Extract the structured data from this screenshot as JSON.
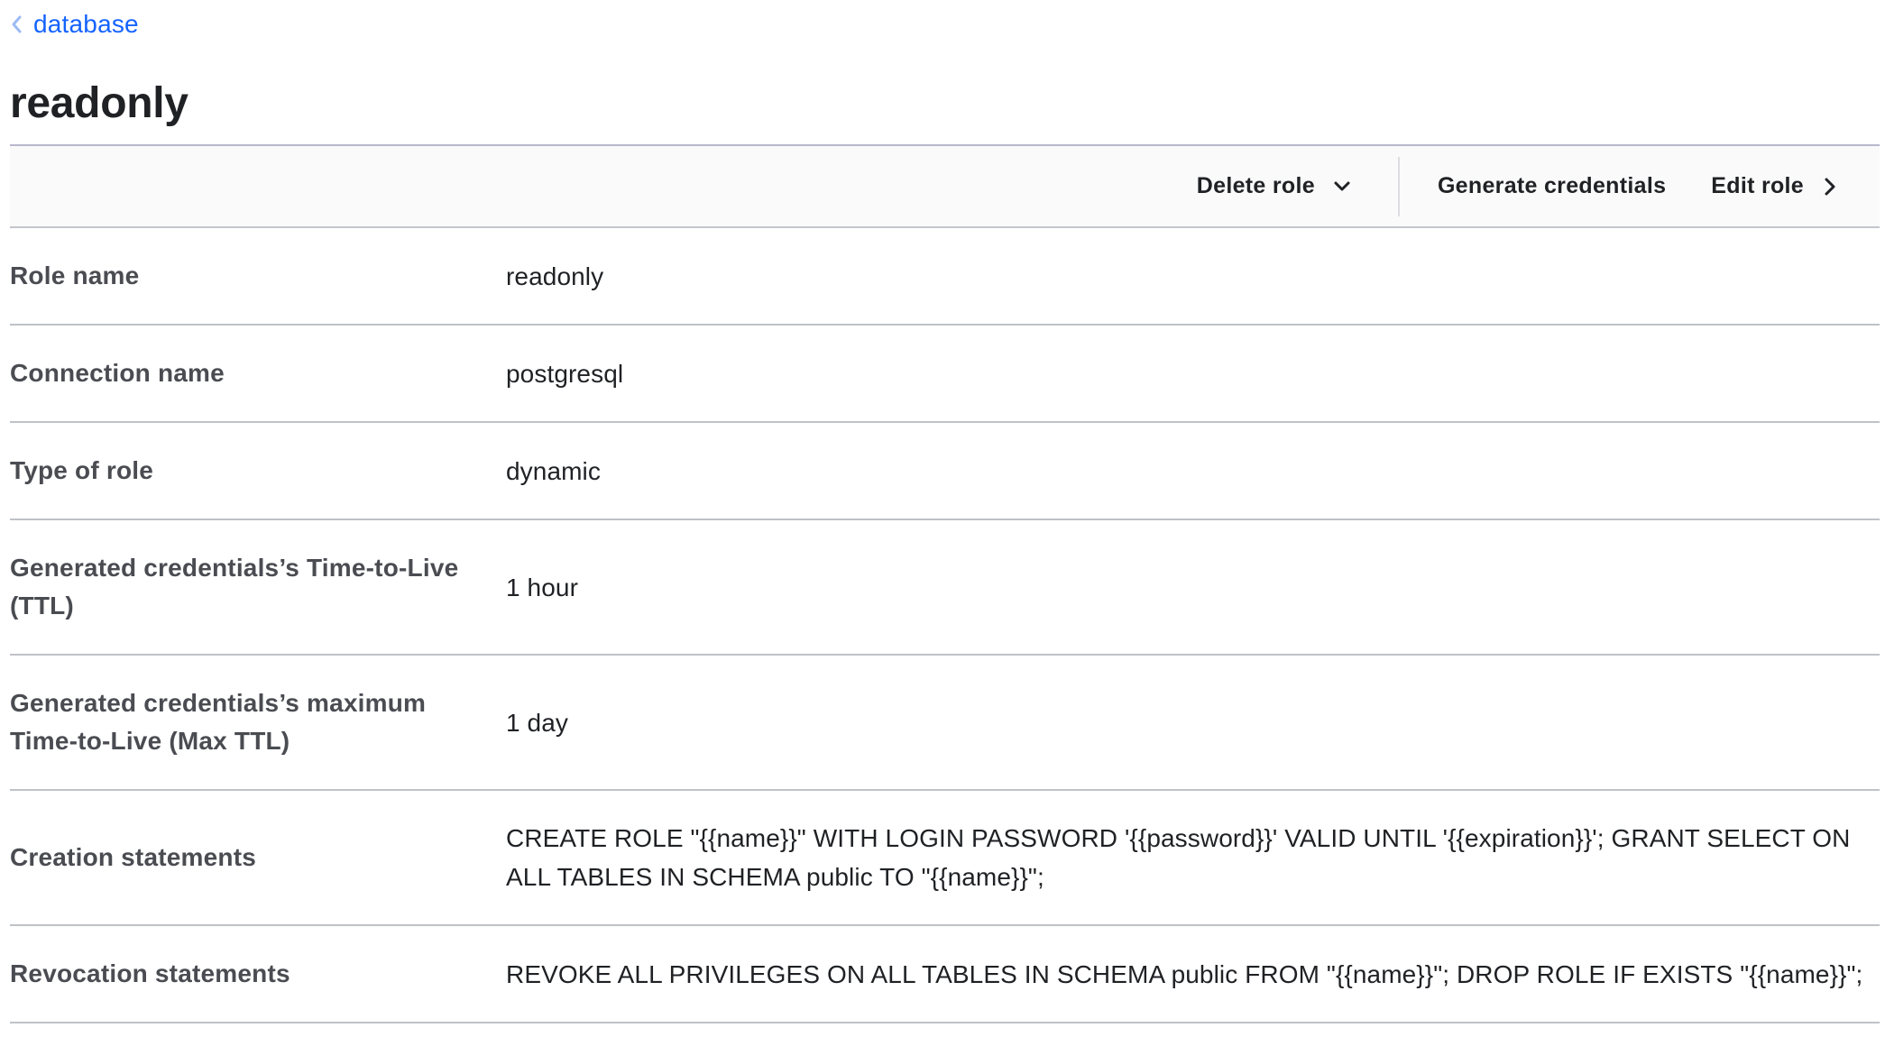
{
  "breadcrumb": {
    "label": "database"
  },
  "page_title": "readonly",
  "toolbar": {
    "delete_label": "Delete role",
    "generate_label": "Generate credentials",
    "edit_label": "Edit role"
  },
  "details": {
    "role_name": {
      "label": "Role name",
      "value": "readonly"
    },
    "connection_name": {
      "label": "Connection name",
      "value": "postgresql"
    },
    "type_of_role": {
      "label": "Type of role",
      "value": "dynamic"
    },
    "ttl": {
      "label": "Generated credentials’s Time-to-Live (TTL)",
      "value": "1 hour"
    },
    "max_ttl": {
      "label": "Generated credentials’s maximum Time-to-Live (Max TTL)",
      "value": "1 day"
    },
    "creation_statements": {
      "label": "Creation statements",
      "value": "CREATE ROLE \"{{name}}\" WITH LOGIN PASSWORD '{{password}}' VALID UNTIL '{{expiration}}'; GRANT SELECT ON ALL TABLES IN SCHEMA public TO \"{{name}}\";"
    },
    "revocation_statements": {
      "label": "Revocation statements",
      "value": "REVOKE ALL PRIVILEGES ON ALL TABLES IN SCHEMA public FROM \"{{name}}\"; DROP ROLE IF EXISTS \"{{name}}\";"
    }
  },
  "colors": {
    "link": "#1563ff",
    "text": "#1f2124",
    "label": "#4a4c52",
    "divider": "#bfc2c7",
    "toolbar_bg": "#fafafa"
  },
  "icons": {
    "breadcrumb": "chevron-left-icon",
    "delete_dropdown": "chevron-down-icon",
    "edit": "chevron-right-icon"
  }
}
